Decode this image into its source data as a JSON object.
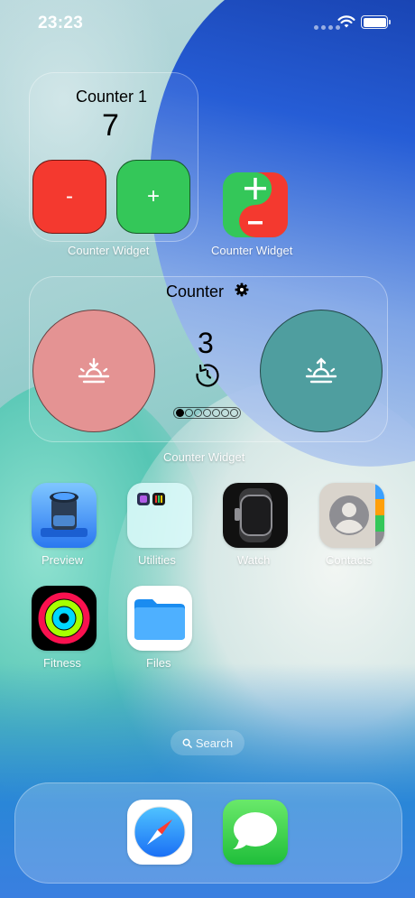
{
  "status_bar": {
    "time": "23:23"
  },
  "widgets": {
    "counter_small": {
      "title": "Counter 1",
      "value": "7",
      "minus_label": "-",
      "plus_label": "+",
      "caption": "Counter Widget"
    },
    "counter_icon": {
      "plus_label": "+",
      "minus_label": "−",
      "caption": "Counter Widget"
    },
    "counter_large": {
      "title": "Counter",
      "value": "3",
      "caption": "Counter Widget",
      "page_dots": 7,
      "active_dot": 0
    }
  },
  "apps": [
    {
      "name": "Preview",
      "icon": "preview-icon"
    },
    {
      "name": "Utilities",
      "icon": "utilities-folder-icon"
    },
    {
      "name": "Watch",
      "icon": "watch-icon"
    },
    {
      "name": "Contacts",
      "icon": "contacts-icon"
    },
    {
      "name": "Fitness",
      "icon": "fitness-icon"
    },
    {
      "name": "Files",
      "icon": "files-icon"
    }
  ],
  "search": {
    "label": "Search"
  },
  "dock": [
    {
      "name": "Safari",
      "icon": "safari-icon"
    },
    {
      "name": "Messages",
      "icon": "messages-icon"
    }
  ],
  "colors": {
    "red": "#f4392f",
    "green": "#34c759",
    "red_circle": "#e49393",
    "teal_circle": "#4f9e9f"
  }
}
